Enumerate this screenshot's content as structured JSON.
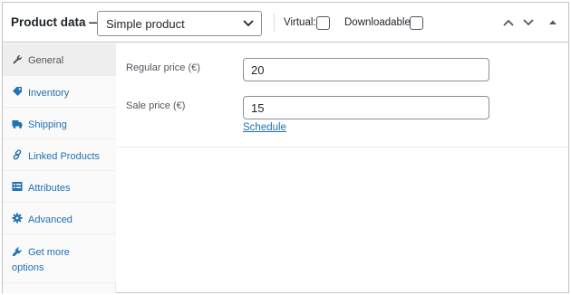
{
  "header": {
    "title": "Product data —",
    "product_type": "Simple product",
    "virtual_label": "Virtual:",
    "downloadable_label": "Downloadable:",
    "virtual_checked": false,
    "downloadable_checked": false
  },
  "tabs": [
    {
      "label": "General",
      "icon": "wrench-icon",
      "active": true
    },
    {
      "label": "Inventory",
      "icon": "tag-icon",
      "active": false
    },
    {
      "label": "Shipping",
      "icon": "truck-icon",
      "active": false
    },
    {
      "label": "Linked Products",
      "icon": "link-icon",
      "active": false
    },
    {
      "label": "Attributes",
      "icon": "list-view-icon",
      "active": false
    },
    {
      "label": "Advanced",
      "icon": "gear-icon",
      "active": false
    },
    {
      "label_line1": "Get more",
      "label_line2": "options",
      "icon": "plugin-icon",
      "active": false
    }
  ],
  "general": {
    "regular_price_label": "Regular price (€)",
    "regular_price_value": "20",
    "sale_price_label": "Sale price (€)",
    "sale_price_value": "15",
    "schedule_link": "Schedule"
  },
  "colors": {
    "link": "#2271b1",
    "border": "#c3c4c7",
    "sidebar_bg": "#fafafa",
    "active_tab_bg": "#eeeeee"
  }
}
